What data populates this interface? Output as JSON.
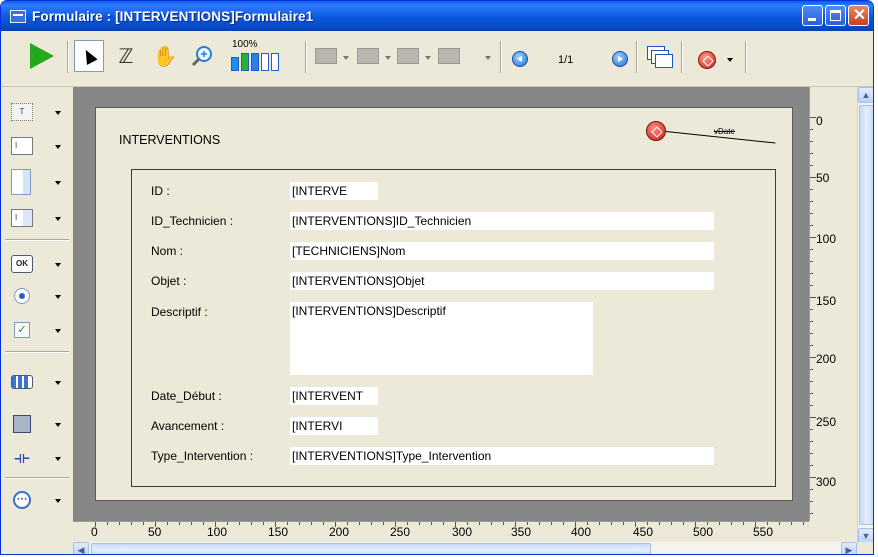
{
  "window": {
    "title": "Formulaire : [INTERVENTIONS]Formulaire1",
    "controls": [
      "minimize-icon",
      "maximize-icon",
      "close-icon"
    ]
  },
  "toolbar": {
    "icons": [
      "play-icon",
      "arrow-pointer-icon",
      "tab-order-icon",
      "hand-icon",
      "zoom-icon",
      "zoom-level-icon",
      "align-icon",
      "distribute-icon",
      "layer-icon",
      "group-icon",
      "previous-page-icon",
      "next-page-icon",
      "overlay-icon",
      "object-method-icon"
    ],
    "zoom_label": "100%",
    "page_counter": "1/1"
  },
  "palette": {
    "tools": [
      {
        "name": "static-text-tool",
        "icon_text": "T"
      },
      {
        "name": "field-tool",
        "icon_text": "I"
      },
      {
        "name": "spinner-tool",
        "icon_text": ""
      },
      {
        "name": "combo-tool",
        "icon_text": "I"
      },
      {
        "name": "button-tool",
        "icon_text": "OK"
      },
      {
        "name": "radio-tool",
        "icon_text": ""
      },
      {
        "name": "checkbox-tool",
        "icon_text": "✓"
      },
      {
        "name": "progress-tool",
        "icon_text": ""
      },
      {
        "name": "rectangle-tool",
        "icon_text": ""
      },
      {
        "name": "line-tool",
        "icon_text": "⟛"
      },
      {
        "name": "plugin-tool",
        "icon_text": "⋯"
      }
    ]
  },
  "form": {
    "title": "INTERVENTIONS",
    "variable_label": "vDate",
    "fields": [
      {
        "label": "ID :",
        "value": "[INTERVE"
      },
      {
        "label": "ID_Technicien :",
        "value": "[INTERVENTIONS]ID_Technicien"
      },
      {
        "label": "Nom :",
        "value": "[TECHNICIENS]Nom"
      },
      {
        "label": "Objet :",
        "value": "[INTERVENTIONS]Objet"
      },
      {
        "label": "Descriptif :",
        "value": "[INTERVENTIONS]Descriptif"
      },
      {
        "label": "Date_Début :",
        "value": "[INTERVENT"
      },
      {
        "label": "Avancement :",
        "value": "[INTERVI"
      },
      {
        "label": "Type_Intervention :",
        "value": "[INTERVENTIONS]Type_Intervention"
      }
    ]
  },
  "rulers": {
    "vertical": [
      "0",
      "50",
      "100",
      "150",
      "200",
      "250",
      "300"
    ],
    "horizontal": [
      "0",
      "50",
      "100",
      "150",
      "200",
      "250",
      "300",
      "350",
      "400",
      "450",
      "500",
      "550"
    ]
  },
  "colors": {
    "titlebar": "#0a5be6",
    "window_bg": "#ece9d8",
    "editor_bg": "#868686",
    "play": "#23a81f",
    "accent_red": "#c31d15"
  }
}
